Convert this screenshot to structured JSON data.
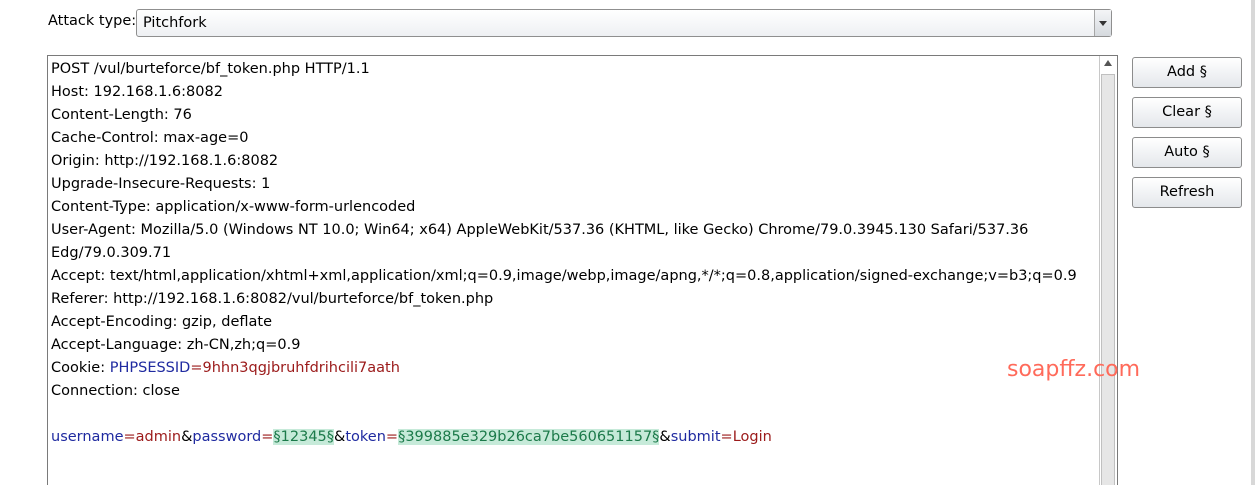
{
  "attack_type": {
    "label": "Attack type:",
    "value": "Pitchfork"
  },
  "buttons": {
    "add": "Add §",
    "clear": "Clear §",
    "auto": "Auto §",
    "refresh": "Refresh"
  },
  "request": {
    "lines": [
      "POST /vul/burteforce/bf_token.php HTTP/1.1",
      "Host: 192.168.1.6:8082",
      "Content-Length: 76",
      "Cache-Control: max-age=0",
      "Origin: http://192.168.1.6:8082",
      "Upgrade-Insecure-Requests: 1",
      "Content-Type: application/x-www-form-urlencoded",
      "User-Agent: Mozilla/5.0 (Windows NT 10.0; Win64; x64) AppleWebKit/537.36 (KHTML, like Gecko) Chrome/79.0.3945.130 Safari/537.36",
      "Edg/79.0.309.71",
      "Accept: text/html,application/xhtml+xml,application/xml;q=0.9,image/webp,image/apng,*/*;q=0.8,application/signed-exchange;v=b3;q=0.9",
      "Referer: http://192.168.1.6:8082/vul/burteforce/bf_token.php",
      "Accept-Encoding: gzip, deflate",
      "Accept-Language: zh-CN,zh;q=0.9"
    ],
    "cookie": {
      "prefix": "Cookie: ",
      "name": "PHPSESSID",
      "eq": "=",
      "value": "9hhn3qgjbruhfdrihcili7aath"
    },
    "connection": "Connection: close",
    "body": {
      "username_key": "username",
      "eq": "=",
      "username_val": "admin",
      "amp": "&",
      "password_key": "password",
      "password_payload": "§12345§",
      "token_key": "token",
      "token_payload": "§399885e329b26ca7be560651157§",
      "submit_key": "submit",
      "submit_val": "Login"
    }
  },
  "watermark": "soapffz.com",
  "colors": {
    "param_name": "#1f2aa0",
    "param_value": "#9b1a1a",
    "payload_bg": "#c6ead9",
    "payload_text": "#1c7a4a",
    "watermark": "#ff6a5a"
  }
}
